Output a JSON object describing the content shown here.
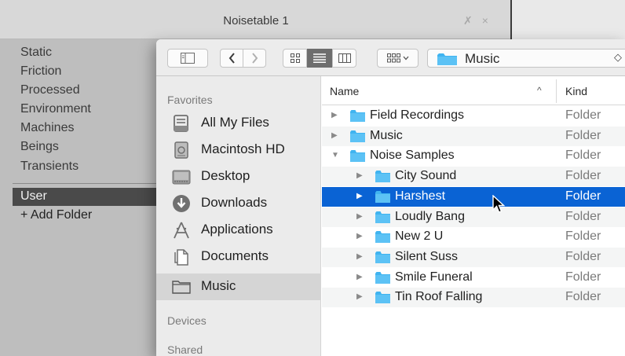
{
  "app": {
    "title": "Noisetable 1",
    "title_icons": [
      "pin-icon",
      "close-icon"
    ],
    "categories": [
      "Static",
      "Friction",
      "Processed",
      "Environment",
      "Machines",
      "Beings",
      "Transients"
    ],
    "user_item": "User",
    "add_folder": "+ Add Folder"
  },
  "toolbar": {
    "path_label": "Music",
    "views": [
      "icon-view-icon",
      "list-view-icon",
      "column-view-icon"
    ],
    "selected_view": "list"
  },
  "sidebar": {
    "favorites_header": "Favorites",
    "items": [
      {
        "label": "All My Files",
        "icon": "all-my-files-icon"
      },
      {
        "label": "Macintosh HD",
        "icon": "hard-drive-icon"
      },
      {
        "label": "Desktop",
        "icon": "desktop-icon"
      },
      {
        "label": "Downloads",
        "icon": "downloads-icon"
      },
      {
        "label": "Applications",
        "icon": "applications-icon"
      },
      {
        "label": "Documents",
        "icon": "documents-icon"
      },
      {
        "label": "Music",
        "icon": "folder-icon"
      }
    ],
    "selected_index": 6,
    "devices_header": "Devices",
    "shared_header": "Shared"
  },
  "list": {
    "col_name": "Name",
    "col_sort": "^",
    "col_kind": "Kind",
    "rows": [
      {
        "name": "Field Recordings",
        "kind": "Folder",
        "level": 0,
        "expanded": false
      },
      {
        "name": "Music",
        "kind": "Folder",
        "level": 0,
        "expanded": false
      },
      {
        "name": "Noise Samples",
        "kind": "Folder",
        "level": 0,
        "expanded": true
      },
      {
        "name": "City Sound",
        "kind": "Folder",
        "level": 1,
        "expanded": false
      },
      {
        "name": "Harshest",
        "kind": "Folder",
        "level": 1,
        "expanded": false,
        "selected": true
      },
      {
        "name": "Loudly Bang",
        "kind": "Folder",
        "level": 1,
        "expanded": false
      },
      {
        "name": "New 2 U",
        "kind": "Folder",
        "level": 1,
        "expanded": false
      },
      {
        "name": "Silent Suss",
        "kind": "Folder",
        "level": 1,
        "expanded": false
      },
      {
        "name": "Smile Funeral",
        "kind": "Folder",
        "level": 1,
        "expanded": false
      },
      {
        "name": "Tin Roof Falling",
        "kind": "Folder",
        "level": 1,
        "expanded": false
      }
    ]
  },
  "colors": {
    "selection": "#0a63d4",
    "folder": "#40b4f0"
  }
}
